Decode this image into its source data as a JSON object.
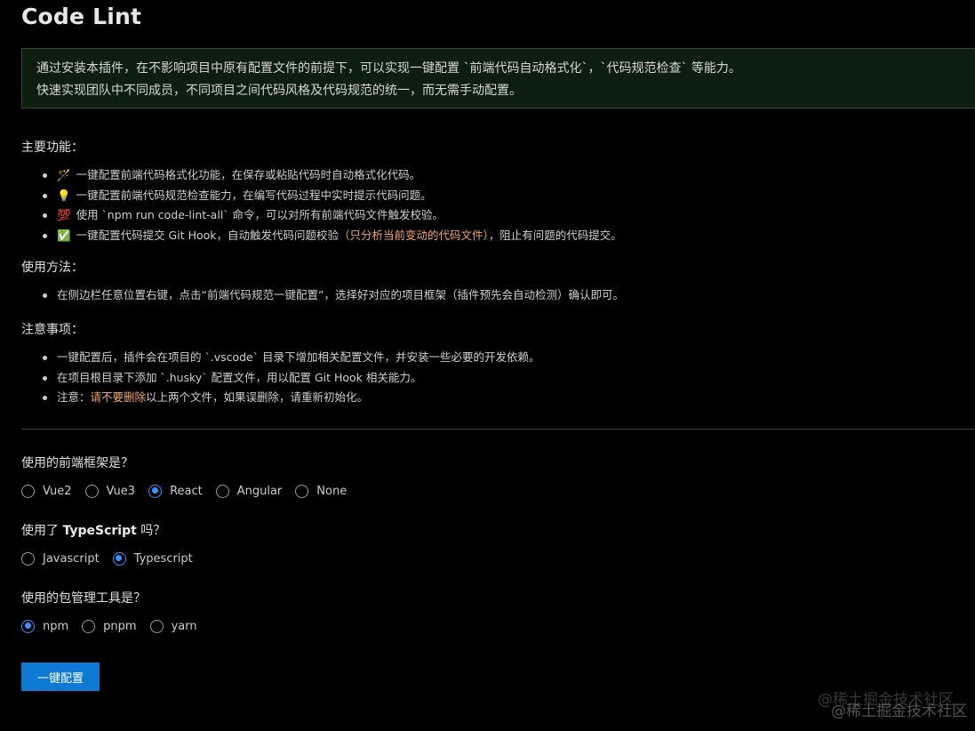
{
  "page_title": "Code Lint",
  "intro": {
    "line1": "通过安装本插件，在不影响项目中原有配置文件的前提下，可以实现一键配置 `前端代码自动格式化`，`代码规范检查` 等能力。",
    "line2": "快速实现团队中不同成员，不同项目之间代码风格及代码规范的统一，而无需手动配置。"
  },
  "features": {
    "heading": "主要功能：",
    "items": [
      {
        "emoji": "🪄",
        "text": "一键配置前端代码格式化功能，在保存或粘贴代码时自动格式化代码。"
      },
      {
        "emoji": "💡",
        "text": "一键配置前端代码规范检查能力，在编写代码过程中实时提示代码问题。"
      },
      {
        "emoji": "💯",
        "text": "使用 `npm run code-lint-all` 命令，可以对所有前端代码文件触发校验。"
      },
      {
        "emoji": "✅",
        "text": "一键配置代码提交 Git Hook，自动触发代码问题校验",
        "highlight": "（只分析当前变动的代码文件）",
        "suffix": "，阻止有问题的代码提交。"
      }
    ]
  },
  "usage": {
    "heading": "使用方法：",
    "items": [
      "在侧边栏任意位置右键，点击“前端代码规范一键配置”，选择好对应的项目框架（插件预先会自动检测）确认即可。"
    ]
  },
  "notes": {
    "heading": "注意事项：",
    "item1": "一键配置后，插件会在项目的 `.vscode` 目录下增加相关配置文件，并安装一些必要的开发依赖。",
    "item2": "在项目根目录下添加 `.husky` 配置文件，用以配置 Git Hook 相关能力。",
    "item3_prefix": "注意：",
    "item3_highlight": "请不要删除",
    "item3_suffix": "以上两个文件，如果误删除，请重新初始化。"
  },
  "framework": {
    "question": "使用的前端框架是？",
    "options": [
      "Vue2",
      "Vue3",
      "React",
      "Angular",
      "None"
    ],
    "selected": "React"
  },
  "typescript": {
    "question_prefix": "使用了 ",
    "question_bold": "TypeScript",
    "question_suffix": " 吗？",
    "options": [
      "Javascript",
      "Typescript"
    ],
    "selected": "Typescript"
  },
  "package_manager": {
    "question": "使用的包管理工具是？",
    "options": [
      "npm",
      "pnpm",
      "yarn"
    ],
    "selected": "npm"
  },
  "submit_label": "一键配置",
  "watermark": "@稀土掘金技术社区",
  "colors": {
    "background": "#000000",
    "intro_background": "#0d1e10",
    "intro_border": "#2e4a31",
    "highlight": "#f0a76d",
    "accent": "#3794ff",
    "button": "#0e7ad3"
  }
}
